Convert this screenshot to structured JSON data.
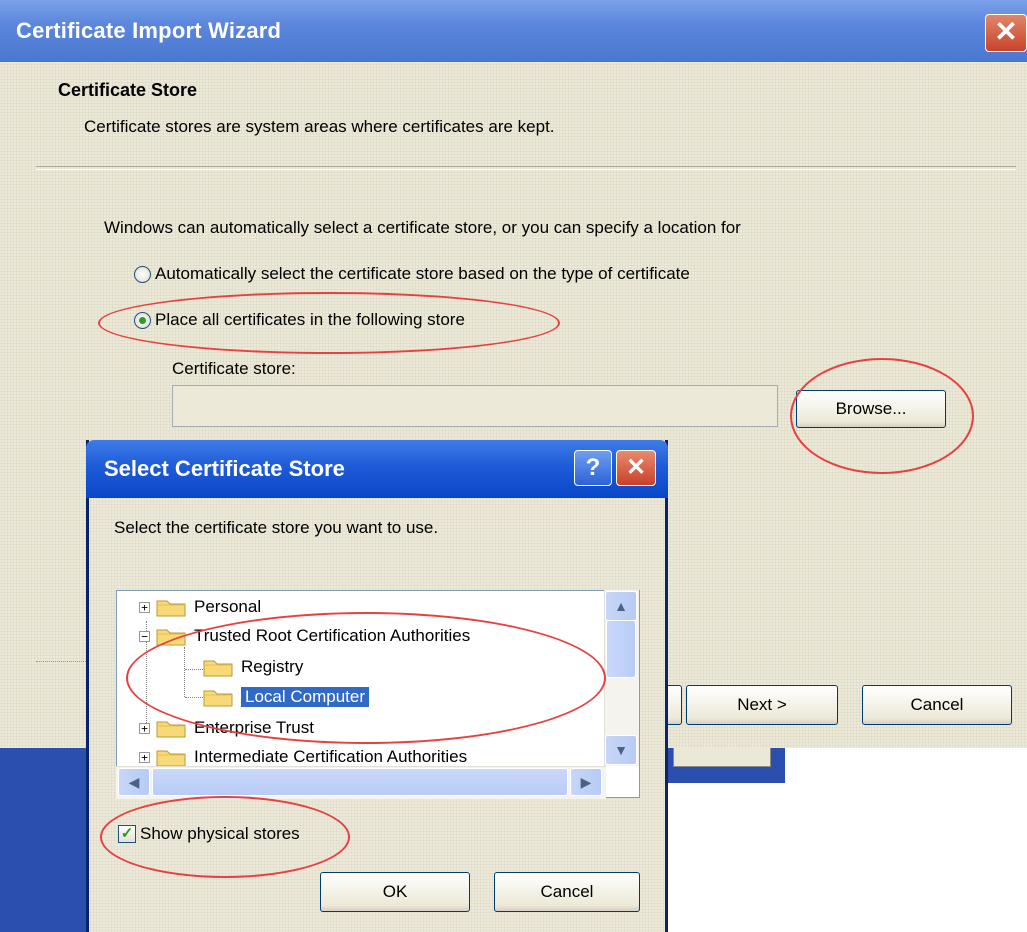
{
  "wizard": {
    "title": "Certificate Import Wizard",
    "close_glyph": "✕",
    "section_title": "Certificate Store",
    "section_description": "Certificate stores are system areas where certificates are kept.",
    "intro": "Windows can automatically select a certificate store, or you can specify a location for",
    "options": [
      {
        "label": "Automatically select the certificate store based on the type of certificate",
        "selected": false
      },
      {
        "label": "Place all certificates in the following store",
        "selected": true
      }
    ],
    "store_label": "Certificate store:",
    "store_value": "",
    "browse_label": "Browse...",
    "next_label": "Next >",
    "cancel_label": "Cancel"
  },
  "dialog": {
    "title": "Select Certificate Store",
    "help_glyph": "?",
    "close_glyph": "✕",
    "prompt": "Select the certificate store you want to use.",
    "tree": [
      {
        "label": "Personal",
        "expander": "+",
        "level": 0
      },
      {
        "label": "Trusted Root Certification Authorities",
        "expander": "−",
        "level": 0
      },
      {
        "label": "Registry",
        "expander": "",
        "level": 1
      },
      {
        "label": "Local Computer",
        "expander": "",
        "level": 1,
        "selected": true
      },
      {
        "label": "Enterprise Trust",
        "expander": "+",
        "level": 0
      },
      {
        "label": "Intermediate Certification Authorities",
        "expander": "+",
        "level": 0
      }
    ],
    "show_physical_label": "Show physical stores",
    "show_physical_checked": true,
    "check_glyph": "✓",
    "ok_label": "OK",
    "cancel_label": "Cancel",
    "scroll_up": "▲",
    "scroll_down": "▼",
    "scroll_left": "◀",
    "scroll_right": "▶"
  },
  "colors": {
    "xp_face": "#ece9d8",
    "title_blue": "#0a47c8",
    "selection": "#316ac5",
    "annotation_red": "#e84040"
  }
}
